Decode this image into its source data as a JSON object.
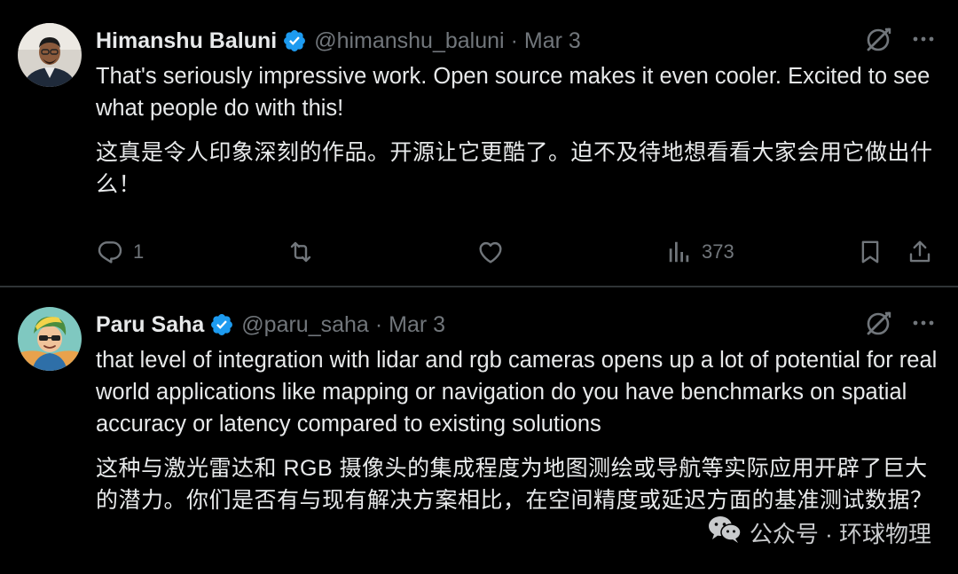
{
  "tweets": [
    {
      "author_name": "Himanshu Baluni",
      "handle": "@himanshu_baluni",
      "separator": "·",
      "date": "Mar 3",
      "text_en": "That's seriously impressive work. Open source makes it even cooler. Excited to see what people do with this!",
      "text_cn": "这真是令人印象深刻的作品。开源让它更酷了。迫不及待地想看看大家会用它做出什么！",
      "reply_count": "1",
      "views_count": "373"
    },
    {
      "author_name": "Paru Saha",
      "handle": "@paru_saha",
      "separator": "·",
      "date": "Mar 3",
      "text_en": "that level of integration with lidar and rgb cameras opens up a lot of potential for real world applications like mapping or navigation do you have benchmarks on spatial accuracy or latency compared to existing solutions",
      "text_cn": "这种与激光雷达和 RGB 摄像头的集成程度为地图测绘或导航等实际应用开辟了巨大的潜力。你们是否有与现有解决方案相比，在空间精度或延迟方面的基准测试数据？"
    }
  ],
  "watermark": {
    "text": "公众号 · 环球物理",
    "icon": "wechat-icon"
  },
  "icons": [
    "verified-badge-icon",
    "grok-icon",
    "more-icon",
    "reply-icon",
    "retweet-icon",
    "like-icon",
    "views-icon",
    "bookmark-icon",
    "share-icon"
  ],
  "colors": {
    "background": "#000000",
    "text": "#e7e9ea",
    "secondary": "#71767b",
    "verified": "#1d9bf0",
    "divider": "#2f3336"
  }
}
